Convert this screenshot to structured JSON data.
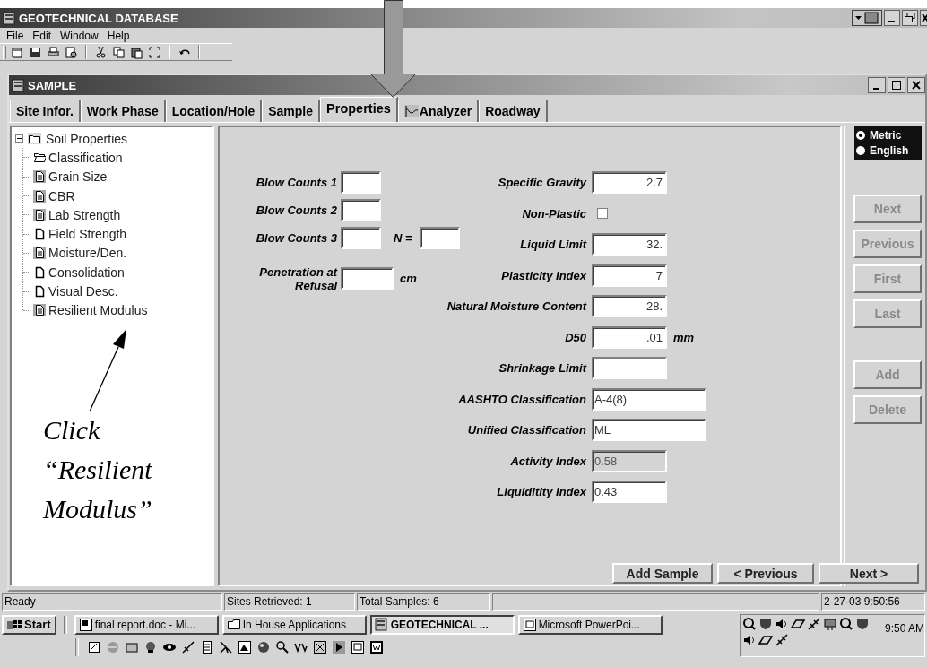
{
  "window": {
    "title": "GEOTECHNICAL DATABASE"
  },
  "menu": [
    "File",
    "Edit",
    "Window",
    "Help"
  ],
  "child_window": {
    "title": "SAMPLE"
  },
  "tabs": [
    {
      "label": "Site Infor.",
      "selected": false,
      "has_icon": false
    },
    {
      "label": "Work Phase",
      "selected": false,
      "has_icon": false
    },
    {
      "label": "Location/Hole",
      "selected": false,
      "has_icon": false
    },
    {
      "label": "Sample",
      "selected": false,
      "has_icon": false
    },
    {
      "label": "Properties",
      "selected": true,
      "has_icon": false
    },
    {
      "label": "Analyzer",
      "selected": false,
      "has_icon": true
    },
    {
      "label": "Roadway",
      "selected": false,
      "has_icon": false
    }
  ],
  "tree": {
    "label": "Soil Properties",
    "expanded": true,
    "children": [
      {
        "label": "Classification",
        "kind": "open-folder"
      },
      {
        "label": "Grain Size",
        "kind": "filled-page"
      },
      {
        "label": "CBR",
        "kind": "filled-page"
      },
      {
        "label": "Lab Strength",
        "kind": "filled-page"
      },
      {
        "label": "Field Strength",
        "kind": "blank-page"
      },
      {
        "label": "Moisture/Den.",
        "kind": "filled-page"
      },
      {
        "label": "Consolidation",
        "kind": "blank-page"
      },
      {
        "label": "Visual Desc.",
        "kind": "blank-page"
      },
      {
        "label": "Resilient Modulus",
        "kind": "filled-page"
      }
    ]
  },
  "blow_counts": [
    {
      "label": "Blow Counts 1"
    },
    {
      "label": "Blow Counts 2"
    },
    {
      "label": "Blow Counts 3"
    }
  ],
  "n_field": {
    "label": "N ="
  },
  "penetration": {
    "label": "Penetration at Refusal",
    "unit": "cm"
  },
  "properties": [
    {
      "label": "Specific Gravity",
      "kind": "number",
      "value": "2.7",
      "disabled": false
    },
    {
      "label": "Non-Plastic",
      "kind": "checkbox",
      "checked": false,
      "disabled": false
    },
    {
      "label": "Liquid Limit",
      "kind": "number",
      "value": "32.",
      "disabled": false
    },
    {
      "label": "Plasticity Index",
      "kind": "number",
      "value": "7",
      "disabled": false
    },
    {
      "label": "Natural Moisture Content",
      "kind": "number",
      "value": "28.",
      "disabled": false
    },
    {
      "label": "D50",
      "kind": "number",
      "value": ".01",
      "unit": "mm",
      "disabled": false
    },
    {
      "label": "Shrinkage Limit",
      "kind": "number",
      "disabled": false
    },
    {
      "label": "AASHTO Classification",
      "kind": "code",
      "value": "A-4(8)",
      "disabled": false
    },
    {
      "label": "Unified Classification",
      "kind": "code",
      "value": "ML",
      "disabled": false
    },
    {
      "label": "Activity Index",
      "kind": "ratio",
      "value": "0.58",
      "disabled": true
    },
    {
      "label": "Liquiditity Index",
      "kind": "ratio",
      "value": "0.43",
      "disabled": false
    }
  ],
  "units": [
    {
      "label": "Metric",
      "selected": true
    },
    {
      "label": "English",
      "selected": false
    }
  ],
  "nav_buttons": [
    {
      "label": "Next",
      "disabled": true
    },
    {
      "label": "Previous",
      "disabled": true
    },
    {
      "label": "First",
      "disabled": true
    },
    {
      "label": "Last",
      "disabled": true
    }
  ],
  "edit_buttons": [
    {
      "label": "Add",
      "disabled": true
    },
    {
      "label": "Delete",
      "disabled": true
    }
  ],
  "bottom_buttons": [
    "Add Sample",
    "< Previous",
    "Next >"
  ],
  "annotation": "Click “Resilient Modulus”",
  "status_bar": [
    "Ready",
    "Sites Retrieved: 1",
    "Total Samples: 6",
    "2-27-03 9:50:56"
  ],
  "taskbar": {
    "start": "Start",
    "tasks": [
      {
        "label": "final report.doc - Mi...",
        "kind": "word",
        "active": false
      },
      {
        "label": "In House Applications",
        "kind": "folder",
        "active": false
      },
      {
        "label": "GEOTECHNICAL ...",
        "kind": "app",
        "active": true
      },
      {
        "label": "Microsoft PowerPoi...",
        "kind": "slides",
        "active": false
      }
    ],
    "clock": "9:50 AM"
  }
}
